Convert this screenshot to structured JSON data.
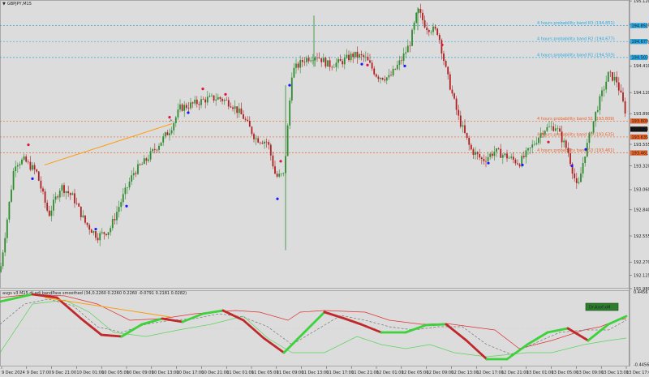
{
  "title": "GBPJPY,M15",
  "colors": {
    "background": "#dcdcdc",
    "bull": "#2e8b2e",
    "bear": "#b02020",
    "band_top": "#2aa7e0",
    "band_bottom": "#e8642a",
    "trendline": "#ff9900",
    "dot_red": "#e0143c",
    "dot_blue": "#1a1aff",
    "osc_fast": "#c0282a",
    "osc_up": "#3cd23c",
    "osc_signal": "#777777",
    "osc_red_line": "#e03030",
    "osc_green_line": "#5bd45b"
  },
  "chart_data": [
    {
      "type": "candlestick",
      "title": "GBPJPY,M15",
      "ylim": [
        191.98,
        195.13
      ],
      "y_ticks": [
        "195.120",
        "194.860",
        "194.670",
        "194.410",
        "194.120",
        "193.890",
        "193.555",
        "193.320",
        "193.060",
        "192.840",
        "192.555",
        "192.270",
        "192.125",
        "191.980"
      ],
      "x_ticks": [
        "9 Dec 2024",
        "9 Dec 17:00",
        "9 Dec 21:00",
        "10 Dec 01:00",
        "10 Dec 05:00",
        "10 Dec 09:00",
        "10 Dec 13:00",
        "10 Dec 17:00",
        "10 Dec 21:00",
        "11 Dec 01:00",
        "11 Dec 05:00",
        "11 Dec 09:00",
        "11 Dec 13:00",
        "11 Dec 17:00",
        "11 Dec 21:00",
        "12 Dec 01:00",
        "12 Dec 05:00",
        "12 Dec 09:00",
        "12 Dec 13:00",
        "12 Dec 17:00",
        "12 Dec 21:00",
        "13 Dec 01:00",
        "13 Dec 05:00",
        "13 Dec 09:00",
        "13 Dec 13:00",
        "13 Dec 17:00"
      ],
      "path": [
        [
          0,
          192.16
        ],
        [
          18,
          193.35
        ],
        [
          30,
          193.38
        ],
        [
          45,
          193.25
        ],
        [
          60,
          192.78
        ],
        [
          75,
          193.1
        ],
        [
          90,
          192.98
        ],
        [
          105,
          192.7
        ],
        [
          120,
          192.55
        ],
        [
          135,
          192.62
        ],
        [
          150,
          192.95
        ],
        [
          165,
          193.25
        ],
        [
          180,
          193.38
        ],
        [
          195,
          193.55
        ],
        [
          210,
          193.72
        ],
        [
          222,
          193.95
        ],
        [
          240,
          194.0
        ],
        [
          255,
          194.05
        ],
        [
          270,
          194.06
        ],
        [
          285,
          194.0
        ],
        [
          300,
          193.85
        ],
        [
          315,
          193.62
        ],
        [
          330,
          193.58
        ],
        [
          340,
          193.2
        ],
        [
          350,
          193.22
        ],
        [
          360,
          194.35
        ],
        [
          375,
          194.48
        ],
        [
          390,
          194.53
        ],
        [
          405,
          194.42
        ],
        [
          420,
          194.45
        ],
        [
          435,
          194.53
        ],
        [
          450,
          194.5
        ],
        [
          465,
          194.3
        ],
        [
          480,
          194.28
        ],
        [
          495,
          194.48
        ],
        [
          505,
          194.65
        ],
        [
          515,
          195.02
        ],
        [
          525,
          194.84
        ],
        [
          540,
          194.78
        ],
        [
          550,
          194.35
        ],
        [
          565,
          193.85
        ],
        [
          580,
          193.5
        ],
        [
          595,
          193.38
        ],
        [
          610,
          193.48
        ],
        [
          625,
          193.42
        ],
        [
          640,
          193.35
        ],
        [
          655,
          193.52
        ],
        [
          670,
          193.72
        ],
        [
          685,
          193.75
        ],
        [
          700,
          193.48
        ],
        [
          712,
          193.05
        ],
        [
          720,
          193.42
        ],
        [
          735,
          193.92
        ],
        [
          750,
          194.32
        ],
        [
          760,
          194.25
        ],
        [
          772,
          193.88
        ]
      ],
      "series": [
        {
          "name": "4 hours probability band R3 (194.851)",
          "value": 194.851,
          "color": "#2aa7e0"
        },
        {
          "name": "4 hours probability band R2 (194.677)",
          "value": 194.677,
          "color": "#2aa7e0"
        },
        {
          "name": "4 hours probability band R1 (194.503)",
          "value": 194.503,
          "color": "#2aa7e0"
        },
        {
          "name": "4 hours probability band S1 (193.809)",
          "value": 193.809,
          "color": "#e8642a"
        },
        {
          "name": "4 hours probability band S2 (193.635)",
          "value": 193.635,
          "color": "#e8642a"
        },
        {
          "name": "4 hours probability band S3 (193.461)",
          "value": 193.461,
          "color": "#e8642a"
        }
      ],
      "right_badges": [
        {
          "value": 194.851,
          "label": "194.851",
          "color": "#2aa7e0"
        },
        {
          "value": 194.677,
          "label": "194.677",
          "color": "#2aa7e0"
        },
        {
          "value": 194.503,
          "label": "194.503",
          "color": "#2aa7e0"
        },
        {
          "value": 193.809,
          "label": "193.809",
          "color": "#e8642a"
        },
        {
          "value": 193.72,
          "label": "193.720",
          "color": "#111111"
        },
        {
          "value": 193.635,
          "label": "193.635",
          "color": "#e8642a"
        },
        {
          "value": 193.461,
          "label": "193.461",
          "color": "#e8642a"
        }
      ],
      "trendline": [
        [
          55,
          193.33
        ],
        [
          212,
          193.78
        ]
      ],
      "marker_dots": [
        {
          "t": 35,
          "v": 193.55,
          "c": "red"
        },
        {
          "t": 40,
          "v": 193.18,
          "c": "blue"
        },
        {
          "t": 118,
          "v": 192.63,
          "c": "blue"
        },
        {
          "t": 156,
          "v": 192.88,
          "c": "blue"
        },
        {
          "t": 209,
          "v": 193.85,
          "c": "red"
        },
        {
          "t": 232,
          "v": 193.9,
          "c": "blue"
        },
        {
          "t": 250,
          "v": 194.16,
          "c": "red"
        },
        {
          "t": 278,
          "v": 194.1,
          "c": "red"
        },
        {
          "t": 342,
          "v": 192.96,
          "c": "blue"
        },
        {
          "t": 346,
          "v": 193.37,
          "c": "red"
        },
        {
          "t": 357,
          "v": 194.2,
          "c": "blue"
        },
        {
          "t": 446,
          "v": 194.43,
          "c": "blue"
        },
        {
          "t": 453,
          "v": 194.42,
          "c": "red"
        },
        {
          "t": 499,
          "v": 194.41,
          "c": "blue"
        },
        {
          "t": 545,
          "v": 194.64,
          "c": "red"
        },
        {
          "t": 602,
          "v": 193.35,
          "c": "blue"
        },
        {
          "t": 644,
          "v": 193.33,
          "c": "blue"
        },
        {
          "t": 676,
          "v": 193.58,
          "c": "red"
        },
        {
          "t": 705,
          "v": 193.32,
          "c": "blue"
        },
        {
          "t": 722,
          "v": 193.5,
          "c": "blue"
        }
      ]
    },
    {
      "type": "line",
      "title": "avgs v3 M15 dj adj bandPass smoothed (34,0.2260 0.2260 0.2260 -0.0791 0.2181 0.0282)",
      "ylim": [
        -0.47,
        0.47
      ],
      "y_ticks": [
        "0.4456",
        "-0.4456"
      ],
      "series": [
        {
          "name": "",
          "color": "#c0282a",
          "points": [
            [
              0,
              0.33
            ],
            [
              40,
              0.42
            ],
            [
              70,
              0.38
            ],
            [
              100,
              0.12
            ],
            [
              125,
              -0.08
            ],
            [
              150,
              -0.1
            ],
            [
              175,
              0.05
            ],
            [
              200,
              0.12
            ],
            [
              225,
              0.08
            ],
            [
              250,
              0.18
            ],
            [
              275,
              0.22
            ],
            [
              300,
              0.1
            ],
            [
              325,
              -0.12
            ],
            [
              350,
              -0.3
            ],
            [
              375,
              -0.05
            ],
            [
              400,
              0.2
            ],
            [
              425,
              0.12
            ],
            [
              445,
              0.05
            ],
            [
              470,
              -0.05
            ],
            [
              500,
              -0.05
            ],
            [
              525,
              0.04
            ],
            [
              550,
              0.05
            ],
            [
              575,
              -0.15
            ],
            [
              600,
              -0.38
            ],
            [
              625,
              -0.38
            ],
            [
              650,
              -0.2
            ],
            [
              675,
              -0.05
            ],
            [
              700,
              0.0
            ],
            [
              725,
              -0.15
            ],
            [
              750,
              0.05
            ],
            [
              772,
              0.15
            ]
          ]
        },
        {
          "name": "",
          "color": "#777777",
          "points": [
            [
              0,
              0.05
            ],
            [
              30,
              0.3
            ],
            [
              60,
              0.36
            ],
            [
              90,
              0.28
            ],
            [
              120,
              0.02
            ],
            [
              150,
              -0.05
            ],
            [
              180,
              0.05
            ],
            [
              210,
              0.1
            ],
            [
              240,
              0.12
            ],
            [
              270,
              0.18
            ],
            [
              300,
              0.14
            ],
            [
              330,
              0.02
            ],
            [
              360,
              -0.2
            ],
            [
              390,
              -0.02
            ],
            [
              420,
              0.16
            ],
            [
              450,
              0.1
            ],
            [
              480,
              0.02
            ],
            [
              510,
              -0.02
            ],
            [
              540,
              0.02
            ],
            [
              570,
              0.02
            ],
            [
              600,
              -0.2
            ],
            [
              630,
              -0.32
            ],
            [
              660,
              -0.18
            ],
            [
              690,
              -0.05
            ],
            [
              720,
              -0.02
            ],
            [
              750,
              -0.02
            ],
            [
              772,
              0.1
            ]
          ]
        },
        {
          "name": "",
          "color": "#e03030",
          "points": [
            [
              0,
              0.38
            ],
            [
              40,
              0.42
            ],
            [
              80,
              0.4
            ],
            [
              120,
              0.3
            ],
            [
              160,
              0.1
            ],
            [
              200,
              0.12
            ],
            [
              240,
              0.18
            ],
            [
              290,
              0.22
            ],
            [
              320,
              0.2
            ],
            [
              355,
              0.1
            ],
            [
              370,
              0.2
            ],
            [
              400,
              0.22
            ],
            [
              450,
              0.2
            ],
            [
              480,
              0.1
            ],
            [
              520,
              0.05
            ],
            [
              550,
              0.06
            ],
            [
              580,
              0.02
            ],
            [
              610,
              -0.02
            ],
            [
              640,
              -0.25
            ],
            [
              680,
              -0.15
            ],
            [
              720,
              -0.02
            ],
            [
              740,
              0.02
            ],
            [
              760,
              0.1
            ],
            [
              772,
              0.12
            ]
          ]
        },
        {
          "name": "",
          "color": "#5bd45b",
          "points": [
            [
              0,
              -0.3
            ],
            [
              40,
              0.3
            ],
            [
              80,
              0.35
            ],
            [
              110,
              0.2
            ],
            [
              140,
              -0.05
            ],
            [
              180,
              -0.1
            ],
            [
              220,
              -0.02
            ],
            [
              260,
              0.05
            ],
            [
              300,
              0.15
            ],
            [
              330,
              -0.12
            ],
            [
              360,
              -0.3
            ],
            [
              400,
              -0.3
            ],
            [
              440,
              -0.1
            ],
            [
              470,
              -0.2
            ],
            [
              500,
              -0.25
            ],
            [
              530,
              -0.2
            ],
            [
              560,
              -0.3
            ],
            [
              600,
              -0.35
            ],
            [
              650,
              -0.3
            ],
            [
              680,
              -0.3
            ],
            [
              720,
              -0.2
            ],
            [
              750,
              -0.15
            ],
            [
              772,
              -0.12
            ]
          ]
        }
      ],
      "trendline": [
        [
          55,
          0.38
        ],
        [
          210,
          0.14
        ]
      ],
      "badge": "Dr.Asof.xM"
    }
  ]
}
